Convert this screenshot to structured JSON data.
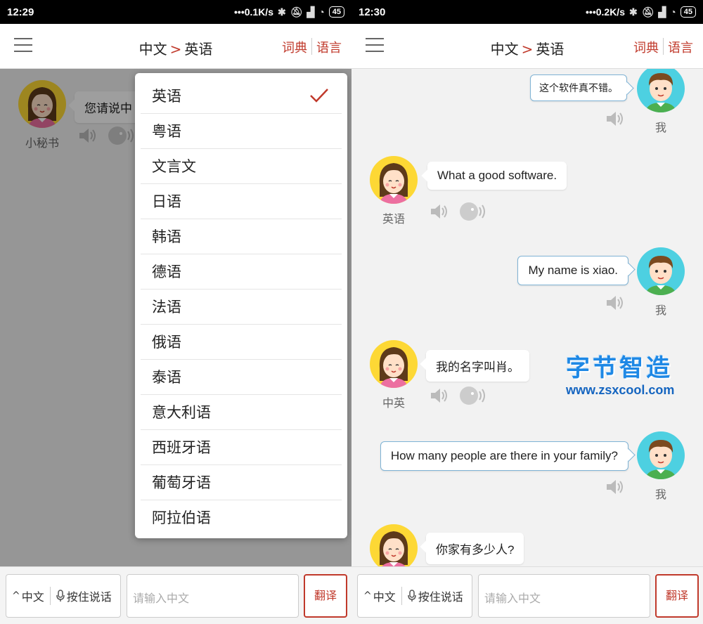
{
  "left": {
    "status": {
      "time": "12:29",
      "speed": "0.1K/s",
      "battery": "45"
    },
    "appbar": {
      "source_lang": "中文",
      "arrow": ">",
      "target_lang": "英语",
      "dict_label": "词典",
      "lang_label": "语言"
    },
    "chat": {
      "bot_name": "小秘书",
      "bot_text": "您请说中"
    },
    "dropdown": {
      "items": [
        "英语",
        "粤语",
        "文言文",
        "日语",
        "韩语",
        "德语",
        "法语",
        "俄语",
        "泰语",
        "意大利语",
        "西班牙语",
        "葡萄牙语",
        "阿拉伯语"
      ],
      "selected": "英语"
    },
    "bottom": {
      "lang_button": "中文",
      "talk_button": "按住说话",
      "input_placeholder": "请输入中文",
      "translate_button": "翻译"
    }
  },
  "right": {
    "status": {
      "time": "12:30",
      "speed": "0.2K/s",
      "battery": "45"
    },
    "appbar": {
      "source_lang": "中文",
      "arrow": ">",
      "target_lang": "英语",
      "dict_label": "词典",
      "lang_label": "语言"
    },
    "messages": [
      {
        "side": "me",
        "text": "这个软件真不错。",
        "name": "我"
      },
      {
        "side": "bot",
        "text": "What a good software.",
        "name": "英语"
      },
      {
        "side": "me",
        "text": "My name is xiao.",
        "name": "我"
      },
      {
        "side": "bot",
        "text": "我的名字叫肖。",
        "name": "中英"
      },
      {
        "side": "me",
        "text": "How many people are there in your family?",
        "name": "我"
      },
      {
        "side": "bot",
        "text": "你家有多少人?",
        "name": ""
      }
    ],
    "watermark": {
      "title": "字节智造",
      "url": "www.zsxcool.com"
    },
    "bottom": {
      "lang_button": "中文",
      "talk_button": "按住说话",
      "input_placeholder": "请输入中文",
      "translate_button": "翻译"
    }
  },
  "colors": {
    "accent": "#c0392b",
    "me_border": "#7fb3d5",
    "girl_bg": "#fdd835",
    "boy_bg": "#4dd0e1"
  },
  "icons": [
    "menu-icon",
    "speaker-icon",
    "voice-play-icon",
    "check-icon",
    "mic-icon",
    "chevron-up-icon",
    "wifi-icon",
    "bluetooth-icon",
    "mute-icon",
    "signal-icon",
    "battery-icon"
  ]
}
